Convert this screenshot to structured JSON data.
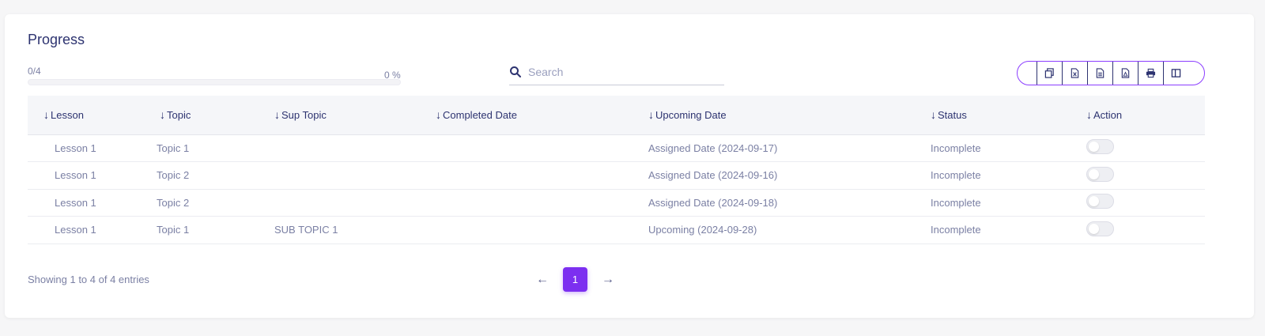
{
  "panel": {
    "title": "Progress",
    "progress_count": "0/4",
    "progress_percent_label": "0 %",
    "progress_fraction": 0
  },
  "search": {
    "placeholder": "Search",
    "value": ""
  },
  "export_buttons": [
    {
      "icon": "copy-icon"
    },
    {
      "icon": "excel-icon"
    },
    {
      "icon": "csv-icon"
    },
    {
      "icon": "pdf-icon"
    },
    {
      "icon": "print-icon"
    },
    {
      "icon": "columns-icon"
    }
  ],
  "table": {
    "columns": [
      "Lesson",
      "Topic",
      "Sup Topic",
      "Completed Date",
      "Upcoming Date",
      "Status",
      "Action"
    ],
    "sort_glyph": "↓",
    "rows": [
      {
        "lesson": "Lesson 1",
        "topic": "Topic 1",
        "sub_topic": "",
        "completed": "",
        "upcoming": "Assigned Date (2024-09-17)",
        "status": "Incomplete",
        "action_on": false
      },
      {
        "lesson": "Lesson 1",
        "topic": "Topic 2",
        "sub_topic": "",
        "completed": "",
        "upcoming": "Assigned Date (2024-09-16)",
        "status": "Incomplete",
        "action_on": false
      },
      {
        "lesson": "Lesson 1",
        "topic": "Topic 2",
        "sub_topic": "",
        "completed": "",
        "upcoming": "Assigned Date (2024-09-18)",
        "status": "Incomplete",
        "action_on": false
      },
      {
        "lesson": "Lesson 1",
        "topic": "Topic 1",
        "sub_topic": "SUB TOPIC 1",
        "completed": "",
        "upcoming": "Upcoming (2024-09-28)",
        "status": "Incomplete",
        "action_on": false
      }
    ]
  },
  "footer": {
    "entries_text": "Showing 1 to 4 of 4 entries",
    "current_page": "1",
    "prev_glyph": "←",
    "next_glyph": "→"
  },
  "colors": {
    "accent": "#7c2ff0",
    "text_dark": "#2d3370",
    "text_muted": "#7b80a4"
  }
}
